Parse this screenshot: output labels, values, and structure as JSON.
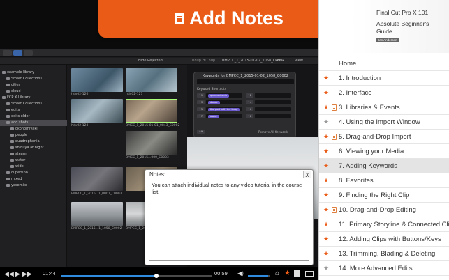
{
  "banner": {
    "icon": "note-document-icon",
    "title": "Add Notes"
  },
  "book": {
    "line1": "Final Cut Pro X 101",
    "line2": "Absolute Beginner's",
    "line3": "Guide",
    "author": "Ian Anderson"
  },
  "toc": {
    "items": [
      {
        "label": "Home",
        "star": "none",
        "note": false,
        "active": false
      },
      {
        "label": "1. Introduction",
        "star": "orange",
        "note": false,
        "active": false
      },
      {
        "label": "2. Interface",
        "star": "orange",
        "note": false,
        "active": false
      },
      {
        "label": "3. Libraries & Events",
        "star": "orange",
        "note": true,
        "active": false
      },
      {
        "label": "4. Using the Import Window",
        "star": "gray",
        "note": false,
        "active": false
      },
      {
        "label": "5. Drag-and-Drop Import",
        "star": "orange",
        "note": true,
        "active": false
      },
      {
        "label": "6. Viewing your Media",
        "star": "orange",
        "note": false,
        "active": false
      },
      {
        "label": "7. Adding Keywords",
        "star": "orange",
        "note": false,
        "active": true
      },
      {
        "label": "8. Favorites",
        "star": "orange",
        "note": false,
        "active": false
      },
      {
        "label": "9. Finding the Right Clip",
        "star": "orange",
        "note": false,
        "active": false
      },
      {
        "label": "10. Drag-and-Drop Editing",
        "star": "orange",
        "note": true,
        "active": false
      },
      {
        "label": "11. Primary Storyline & Connected Clip",
        "star": "orange",
        "note": false,
        "active": false
      },
      {
        "label": "12. Adding Clips with Buttons/Keys",
        "star": "orange",
        "note": false,
        "active": false
      },
      {
        "label": "13. Trimming, Blading & Deleting",
        "star": "orange",
        "note": false,
        "active": false
      },
      {
        "label": "14. More Advanced Edits",
        "star": "gray",
        "note": false,
        "active": false
      }
    ],
    "star_colors": {
      "orange": "#ea5b17",
      "gray": "#9a9a9a"
    }
  },
  "notes": {
    "title": "Notes:",
    "close": "X",
    "text": "You can attach individual notes to any video tutorial in the course list."
  },
  "player": {
    "elapsed": "01:44",
    "remaining": "00:59",
    "progress": 0.63,
    "volume": 0.9,
    "accent": "#2f8bde"
  },
  "fcp": {
    "hide_rejected": "Hide Rejected",
    "clip_name": "1080p HD 30p...",
    "viewer_name": "BMPCC_1_2015-01-02_1058_C0002",
    "zoom": "49%",
    "view": "View",
    "keywords_title": "Keywords for BMPCC_1_2015-01-02_1058_C0002",
    "keyword_shortcuts": "Keyword Shortcuts",
    "remove_all": "Remove All Keywords",
    "keys": [
      "^1",
      "^2",
      "^3",
      "^4",
      "^5",
      "^6",
      "^7",
      "^8",
      "^9"
    ],
    "tags": [
      "quadrophenia",
      "dance",
      "the part with the imag",
      "water"
    ],
    "library": [
      "example library",
      "Smart Collections",
      "cities",
      "cloud",
      "FCP X Library",
      "Smart Collections",
      "edits",
      "edits older",
      "add shots",
      "okonomiyaki",
      "people",
      "quadrophenia",
      "shibuya at night",
      "steam",
      "water",
      "wide",
      "cupertino",
      "mixed",
      "yosemite"
    ],
    "clips": [
      "hdv02-126",
      "hdv02-127",
      "hdv02-128",
      "BMCC_1_2015-01-01_0843_C0002",
      "BMCC_1_2015...000_C0003",
      "BMPCC_1_2015...1_0001_C0002",
      "BMPCC_1_2015...1_1058_C0002",
      "BMPCC_1_2015...3_1105_C0002"
    ]
  }
}
